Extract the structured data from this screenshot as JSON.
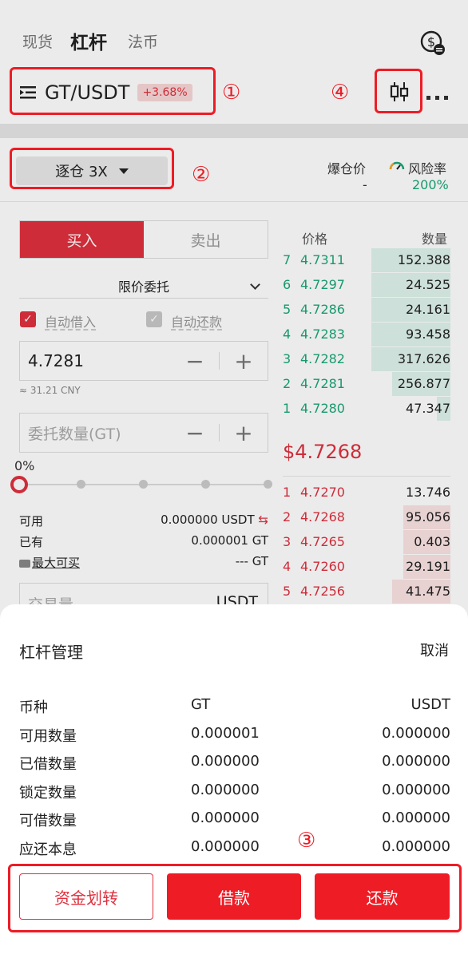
{
  "header": {
    "tabs": [
      {
        "label": "现货",
        "active": false
      },
      {
        "label": "杠杆",
        "active": true
      },
      {
        "label": "法币",
        "active": false
      }
    ],
    "pair": "GT/USDT",
    "change": "+3.68%",
    "icons": [
      "menu-icon",
      "coin-swap-icon",
      "candlestick-icon",
      "more-icon"
    ]
  },
  "annotations": [
    "①",
    "②",
    "③",
    "④"
  ],
  "leverage": {
    "mode": "逐仓 3X",
    "liq_label": "爆仓价",
    "liq_value": "-",
    "risk_label": "风险率",
    "risk_value": "200%"
  },
  "order_form": {
    "buy_label": "买入",
    "sell_label": "卖出",
    "order_type": "限价委托",
    "auto_borrow": "自动借入",
    "auto_repay": "自动还款",
    "price_value": "4.7281",
    "price_cny": "≈ 31.21 CNY",
    "qty_placeholder": "委托数量(GT)",
    "minus": "−",
    "plus": "+",
    "slider_percent": "0%",
    "slider_value": 0,
    "available_label": "可用",
    "available_value": "0.000000 USDT",
    "held_label": "已有",
    "held_value": "0.000001 GT",
    "max_buy_label": "最大可买",
    "max_buy_value": "--- GT",
    "amount_label": "交易量",
    "amount_unit": "USDT"
  },
  "order_book": {
    "price_header": "价格",
    "qty_header": "数量",
    "asks": [
      {
        "lvl": "7",
        "price": "4.7311",
        "qty": "152.388",
        "depth": 0.47
      },
      {
        "lvl": "6",
        "price": "4.7297",
        "qty": "24.525",
        "depth": 0.47
      },
      {
        "lvl": "5",
        "price": "4.7286",
        "qty": "24.161",
        "depth": 0.47
      },
      {
        "lvl": "4",
        "price": "4.7283",
        "qty": "93.458",
        "depth": 0.47
      },
      {
        "lvl": "3",
        "price": "4.7282",
        "qty": "317.626",
        "depth": 0.47
      },
      {
        "lvl": "2",
        "price": "4.7281",
        "qty": "256.877",
        "depth": 0.35
      },
      {
        "lvl": "1",
        "price": "4.7280",
        "qty": "47.347",
        "depth": 0.08
      }
    ],
    "last_price": "$4.7268",
    "bids": [
      {
        "lvl": "1",
        "price": "4.7270",
        "qty": "13.746",
        "depth": 0.0
      },
      {
        "lvl": "2",
        "price": "4.7268",
        "qty": "95.056",
        "depth": 0.28
      },
      {
        "lvl": "3",
        "price": "4.7265",
        "qty": "0.403",
        "depth": 0.28
      },
      {
        "lvl": "4",
        "price": "4.7260",
        "qty": "29.191",
        "depth": 0.28
      },
      {
        "lvl": "5",
        "price": "4.7256",
        "qty": "41.475",
        "depth": 0.35
      }
    ]
  },
  "sheet": {
    "title": "杠杆管理",
    "cancel": "取消",
    "rows": [
      {
        "c1": "币种",
        "c2": "GT",
        "c3": "USDT"
      },
      {
        "c1": "可用数量",
        "c2": "0.000001",
        "c3": "0.000000"
      },
      {
        "c1": "已借数量",
        "c2": "0.000000",
        "c3": "0.000000"
      },
      {
        "c1": "锁定数量",
        "c2": "0.000000",
        "c3": "0.000000"
      },
      {
        "c1": "可借数量",
        "c2": "0.000000",
        "c3": "0.000000"
      },
      {
        "c1": "应还本息",
        "c2": "0.000000",
        "c3": "0.000000"
      }
    ],
    "transfer_btn": "资金划转",
    "borrow_btn": "借款",
    "repay_btn": "还款"
  },
  "colors": {
    "accent_red": "#e0303e",
    "annotation_red": "#ee1c25",
    "green": "#1aa678"
  }
}
